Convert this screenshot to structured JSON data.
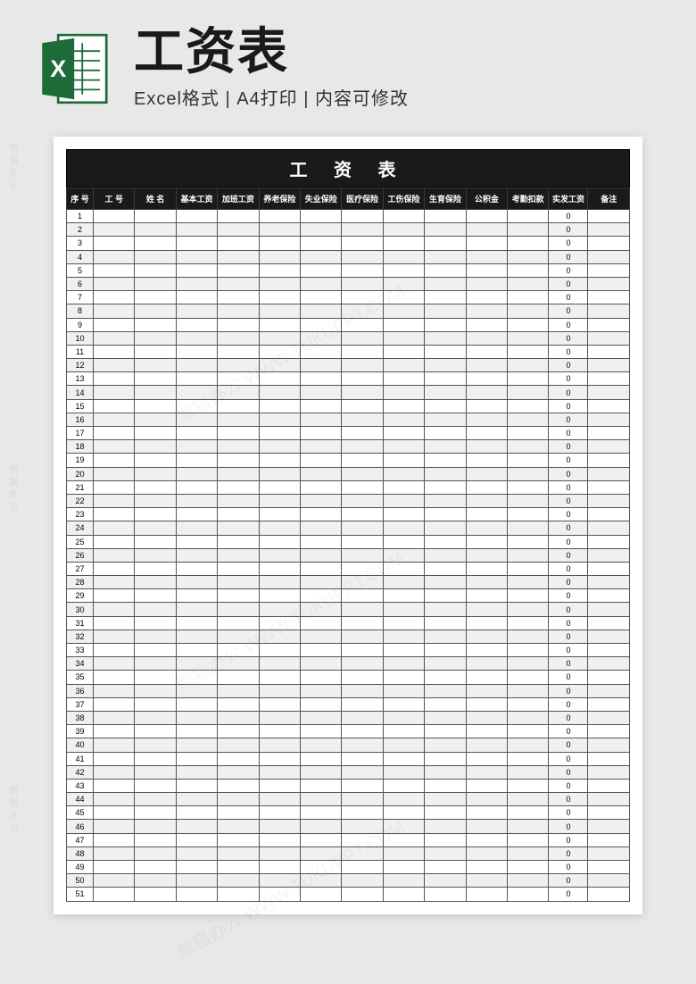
{
  "header": {
    "title": "工资表",
    "subtitle_parts": [
      "Excel格式",
      "A4打印",
      "内容可修改"
    ],
    "separator": " | "
  },
  "sheet": {
    "title": "工 资 表",
    "columns": [
      "序 号",
      "工 号",
      "姓 名",
      "基本工资",
      "加班工资",
      "养老保险",
      "失业保险",
      "医疗保险",
      "工伤保险",
      "生育保险",
      "公积金",
      "考勤扣款",
      "实发工资",
      "备注"
    ],
    "row_count": 51,
    "net_pay_default": "0"
  },
  "watermark": {
    "text": "熊猫办公 WWW.TUKUPPT.COM",
    "side_text": "熊猫办公"
  },
  "chart_data": {
    "type": "table",
    "title": "工资表",
    "columns": [
      "序号",
      "工号",
      "姓名",
      "基本工资",
      "加班工资",
      "养老保险",
      "失业保险",
      "医疗保险",
      "工伤保险",
      "生育保险",
      "公积金",
      "考勤扣款",
      "实发工资",
      "备注"
    ],
    "rows_description": "51 empty rows; 序号 column indexes 1–51; 实发工资 column shows 0 for every row; all other cells blank"
  }
}
